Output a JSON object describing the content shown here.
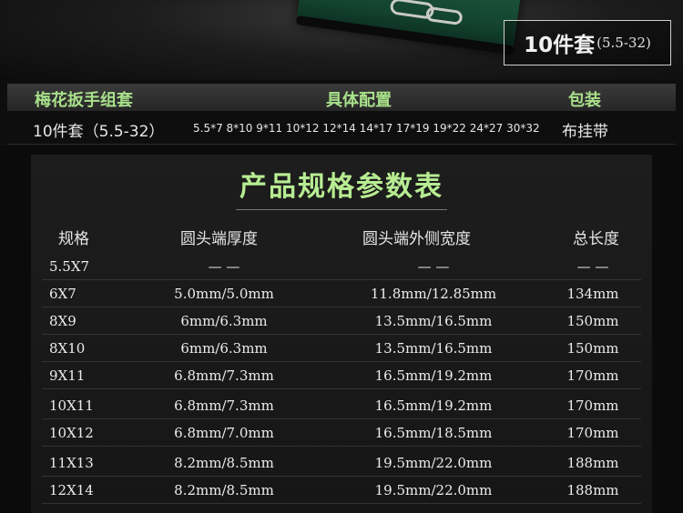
{
  "hero": {
    "badge_big": "10件套",
    "badge_small": "(5.5-32)"
  },
  "config": {
    "headers": [
      "梅花扳手组套",
      "具体配置",
      "包装"
    ],
    "row": {
      "set": "10件套（5.5-32）",
      "sizes": "5.5*7 8*10 9*11 10*12 12*14 14*17 17*19 19*22 24*27 30*32",
      "packaging": "布挂带"
    }
  },
  "params": {
    "title": "产品规格参数表",
    "headers": [
      "规格",
      "圆头端厚度",
      "圆头端外侧宽度",
      "总长度"
    ],
    "rows": [
      [
        "5.5X7",
        "— —",
        "— —",
        "— —"
      ],
      [
        "6X7",
        "5.0mm/5.0mm",
        "11.8mm/12.85mm",
        "134mm"
      ],
      [
        "8X9",
        "6mm/6.3mm",
        "13.5mm/16.5mm",
        "150mm"
      ],
      [
        "8X10",
        "6mm/6.3mm",
        "13.5mm/16.5mm",
        "150mm"
      ],
      [
        "9X11",
        "6.8mm/7.3mm",
        "16.5mm/19.2mm",
        "170mm"
      ],
      [
        "10X11",
        "6.8mm/7.3mm",
        "16.5mm/19.2mm",
        "170mm"
      ],
      [
        "10X12",
        "6.8mm/7.0mm",
        "16.5mm/18.5mm",
        "170mm"
      ],
      [
        "11X13",
        "8.2mm/8.5mm",
        "19.5mm/22.0mm",
        "188mm"
      ],
      [
        "12X14",
        "8.2mm/8.5mm",
        "19.5mm/22.0mm",
        "188mm"
      ]
    ]
  },
  "colors": {
    "accent_green": "#b7ec92",
    "header_green": "#a8e08a"
  }
}
